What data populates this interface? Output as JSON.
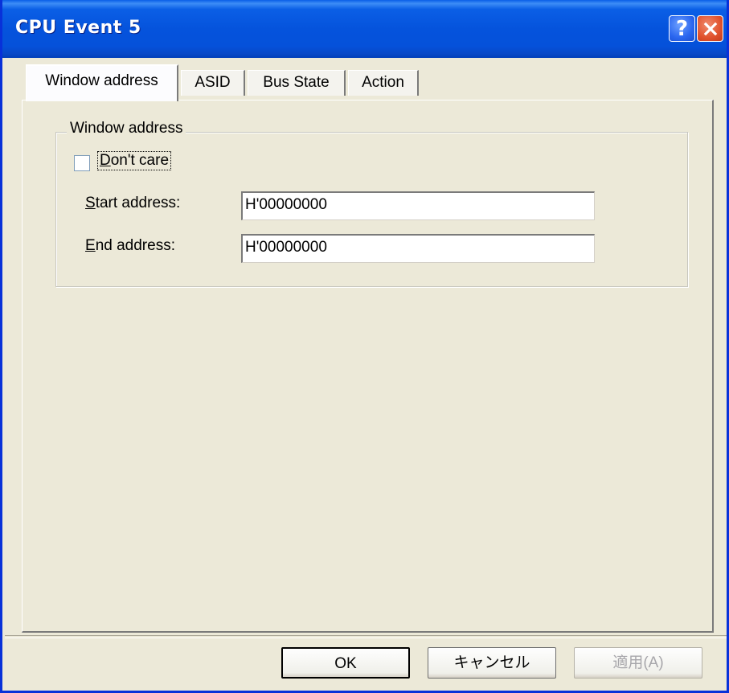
{
  "window": {
    "title": "CPU Event 5",
    "help_glyph": "?",
    "close_icon": "close-icon"
  },
  "tabs": [
    {
      "label": "Window address",
      "active": true
    },
    {
      "label": "ASID",
      "active": false
    },
    {
      "label": "Bus State",
      "active": false
    },
    {
      "label": "Action",
      "active": false
    }
  ],
  "group": {
    "title": "Window address",
    "dont_care": {
      "label": "Don't care",
      "checked": false
    },
    "start_address": {
      "label": "Start address:",
      "value": "H'00000000"
    },
    "end_address": {
      "label": "End address:",
      "value": "H'00000000"
    }
  },
  "buttons": {
    "ok": "OK",
    "cancel": "キャンセル",
    "apply": "適用(A)"
  },
  "colors": {
    "titlebar": "#0553dc",
    "face": "#ece9d8",
    "close": "#e0512c"
  }
}
